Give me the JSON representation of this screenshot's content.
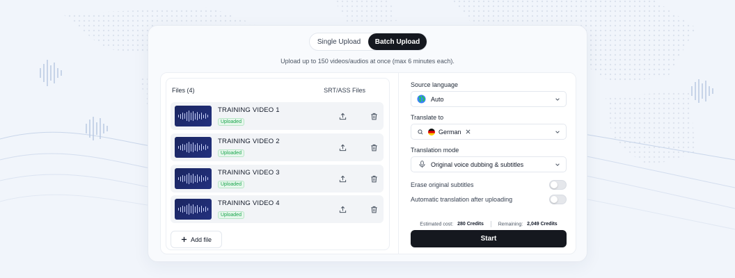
{
  "tabs": {
    "single": "Single Upload",
    "batch": "Batch Upload"
  },
  "upload_hint": "Upload up to 150 videos/audios at once (max 6 minutes each).",
  "files_panel": {
    "title": "Files (4)",
    "column_label": "SRT/ASS Files",
    "files": [
      {
        "name": "TRAINING VIDEO 1",
        "status": "Uploaded"
      },
      {
        "name": "TRAINING VIDEO 2",
        "status": "Uploaded"
      },
      {
        "name": "TRAINING VIDEO 3",
        "status": "Uploaded"
      },
      {
        "name": "TRAINING VIDEO 4",
        "status": "Uploaded"
      }
    ],
    "add_file_label": "Add file"
  },
  "settings": {
    "source_language_label": "Source language",
    "source_language_value": "Auto",
    "translate_to_label": "Translate to",
    "translate_to_value": "German",
    "translation_mode_label": "Translation mode",
    "translation_mode_value": "Original voice dubbing & subtitles",
    "erase_subtitles_label": "Erase original subtitles",
    "erase_subtitles_on": false,
    "auto_translate_label": "Automatic translation after uploading",
    "auto_translate_on": false
  },
  "cost": {
    "estimated_label": "Estimated cost:",
    "estimated_value": "280 Credits",
    "remaining_label": "Remaining:",
    "remaining_value": "2,049 Credits"
  },
  "start_label": "Start",
  "colors": {
    "primary_dark": "#15181f",
    "success_green": "#16a34a",
    "thumbnail_blue": "#1a2560"
  }
}
